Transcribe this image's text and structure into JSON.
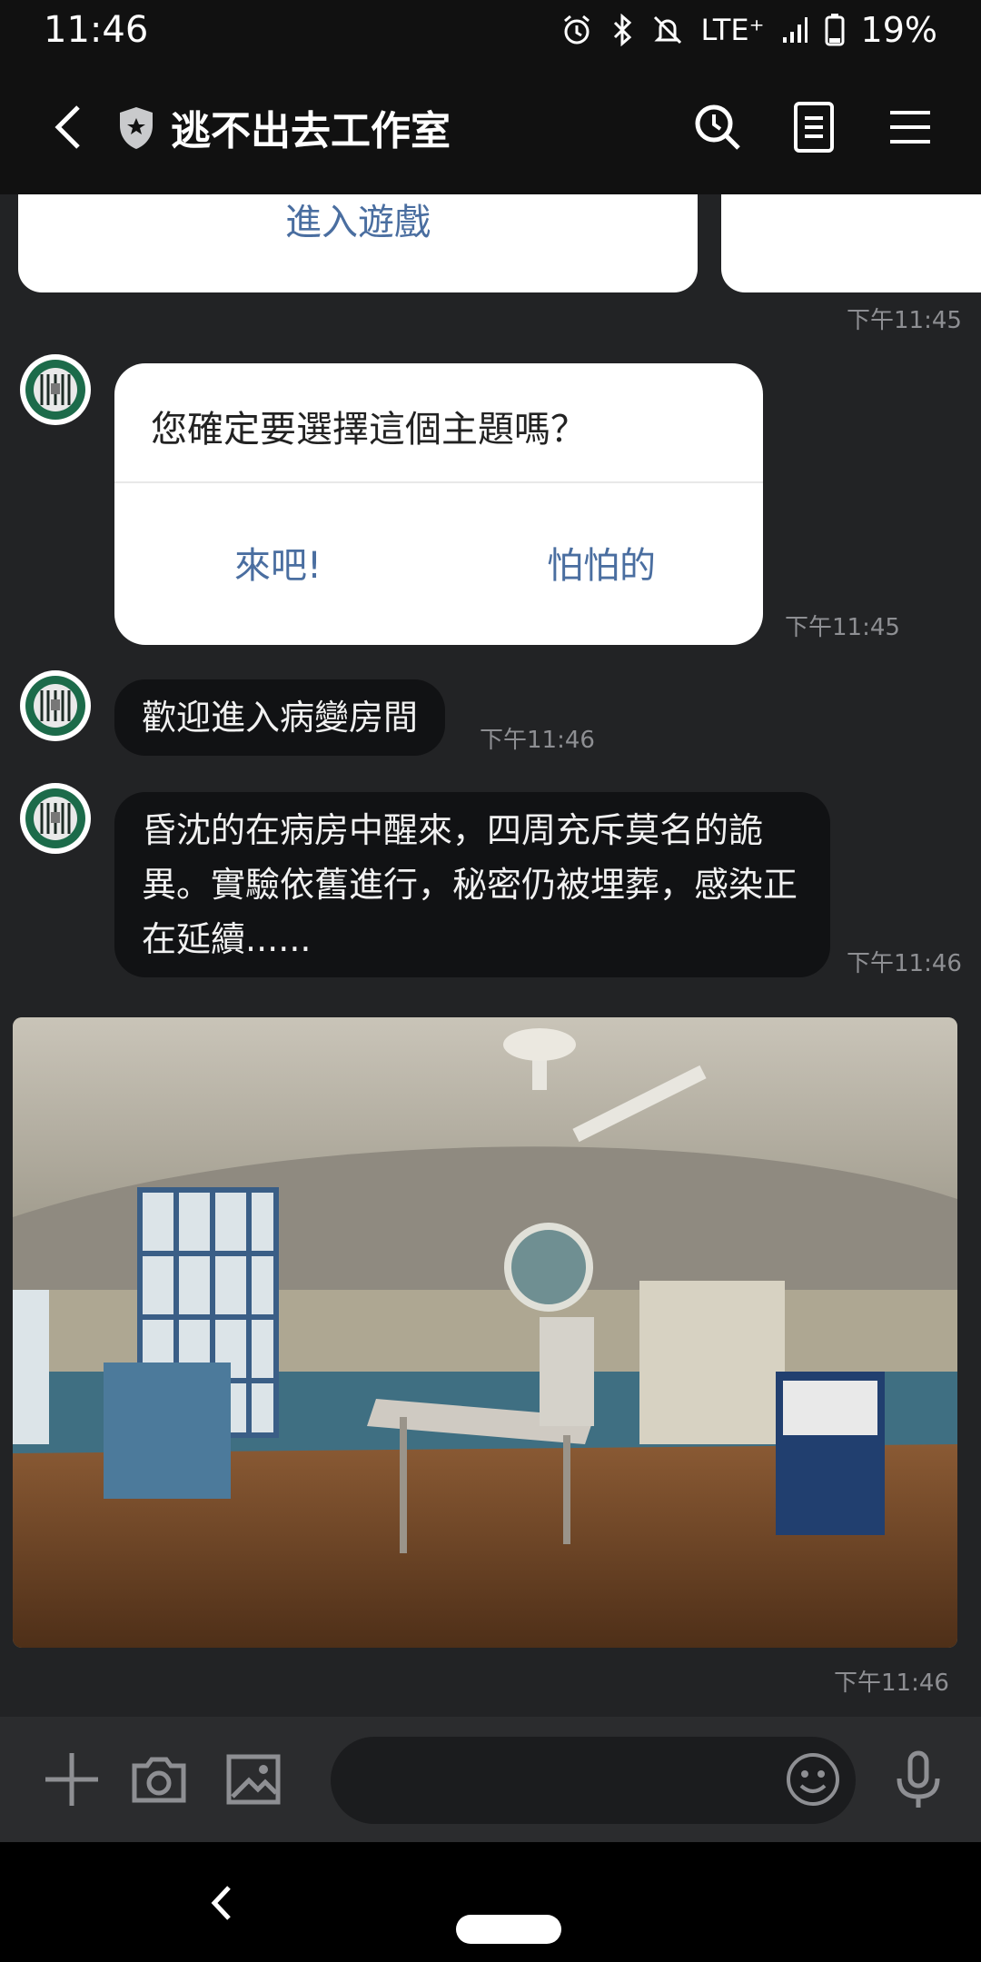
{
  "status_bar": {
    "time": "11:46",
    "network": "LTE⁺",
    "battery": "19%"
  },
  "header": {
    "title": "逃不出去工作室"
  },
  "chat": {
    "prev_card_button": "進入遊戲",
    "prev_card_time": "下午11:45",
    "confirm": {
      "question": "您確定要選擇這個主題嗎？",
      "option_yes": "來吧!",
      "option_no": "怕怕的",
      "time": "下午11:45"
    },
    "messages": [
      {
        "text": "歡迎進入病變房間",
        "time": "下午11:46"
      },
      {
        "text": "昏沈的在病房中醒來，四周充斥莫名的詭異。實驗依舊進行，秘密仍被埋葬，感染正在延續......",
        "time": "下午11:46"
      }
    ],
    "photo_time": "下午11:46"
  },
  "colors": {
    "background": "#222325",
    "bar": "#111111",
    "bubble": "#111214",
    "link_blue": "#4a6ea0",
    "timestamp": "#8e8f93"
  },
  "icons": [
    "alarm-icon",
    "bluetooth-icon",
    "bell-off-icon",
    "signal-icon",
    "battery-icon",
    "back-icon",
    "shield-icon",
    "search-icon",
    "notes-icon",
    "menu-icon",
    "plus-icon",
    "camera-icon",
    "gallery-icon",
    "emoji-icon",
    "mic-icon"
  ]
}
